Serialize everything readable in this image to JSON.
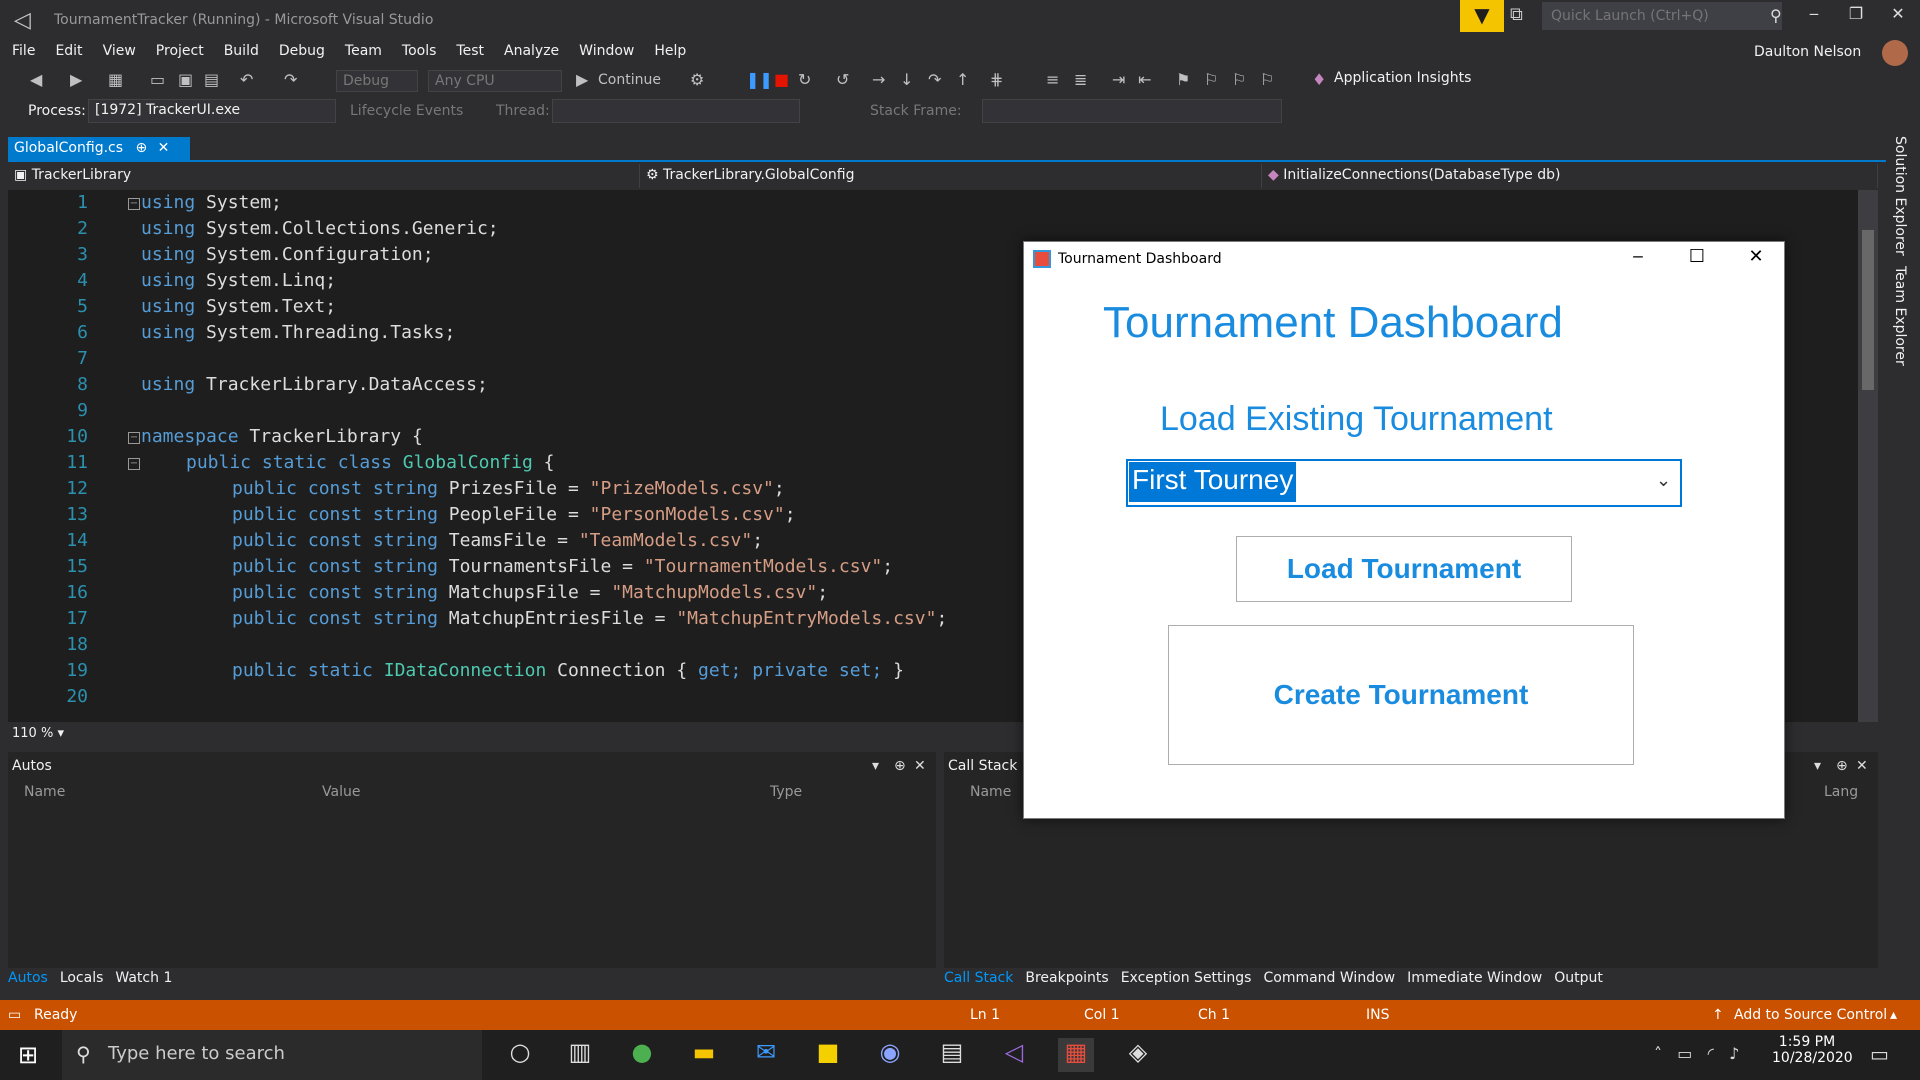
{
  "window": {
    "title": "TournamentTracker (Running) - Microsoft Visual Studio",
    "quick_launch_placeholder": "Quick Launch (Ctrl+Q)",
    "user": "Daulton Nelson"
  },
  "menu": [
    "File",
    "Edit",
    "View",
    "Project",
    "Build",
    "Debug",
    "Team",
    "Tools",
    "Test",
    "Analyze",
    "Window",
    "Help"
  ],
  "toolbar": {
    "config": "Debug",
    "platform": "Any CPU",
    "continue": "Continue",
    "app_insights": "Application Insights"
  },
  "debugbar": {
    "process_label": "Process:",
    "process_value": "[1972] TrackerUI.exe",
    "lifecycle": "Lifecycle Events",
    "thread_label": "Thread:",
    "stackframe_label": "Stack Frame:"
  },
  "editor": {
    "tab_name": "GlobalConfig.cs",
    "nav_project": "TrackerLibrary",
    "nav_class": "TrackerLibrary.GlobalConfig",
    "nav_member": "InitializeConnections(DatabaseType db)",
    "zoom": "110 %",
    "line_numbers": [
      "1",
      "2",
      "3",
      "4",
      "5",
      "6",
      "7",
      "8",
      "9",
      "10",
      "11",
      "12",
      "13",
      "14",
      "15",
      "16",
      "17",
      "18",
      "19",
      "20"
    ],
    "code": {
      "l1": "System;",
      "l2": "System.Collections.Generic;",
      "l3": "System.Configuration;",
      "l4": "System.Linq;",
      "l5": "System.Text;",
      "l6": "System.Threading.Tasks;",
      "l8": "TrackerLibrary.DataAccess;",
      "l10": "TrackerLibrary {",
      "l11_class": "GlobalConfig",
      "kw_using": "using",
      "kw_namespace": "namespace",
      "kw_public_static_class": "public static class",
      "kw_public_const_string": "public const string",
      "kw_public_static": "public static",
      "kw_get": "get;",
      "kw_private_set": "private set;",
      "type_idc": "IDataConnection",
      "prizes_name": "PrizesFile",
      "prizes_val": "\"PrizeModels.csv\"",
      "people_name": "PeopleFile",
      "people_val": "\"PersonModels.csv\"",
      "teams_name": "TeamsFile",
      "teams_val": "\"TeamModels.csv\"",
      "tourn_name": "TournamentsFile",
      "tourn_val": "\"TournamentModels.csv\"",
      "matchups_name": "MatchupsFile",
      "matchups_val": "\"MatchupModels.csv\"",
      "entries_name": "MatchupEntriesFile",
      "entries_val": "\"MatchupEntryModels.csv\"",
      "conn_name": "Connection {",
      "brace_open": "{",
      "brace_close": "}"
    }
  },
  "autos": {
    "title": "Autos",
    "columns": [
      "Name",
      "Value",
      "Type"
    ],
    "tabs": [
      "Autos",
      "Locals",
      "Watch 1"
    ]
  },
  "callstack": {
    "title": "Call Stack",
    "columns": [
      "Name",
      "Lang"
    ],
    "tabs": [
      "Call Stack",
      "Breakpoints",
      "Exception Settings",
      "Command Window",
      "Immediate Window",
      "Output"
    ]
  },
  "status": {
    "ready": "Ready",
    "ln": "Ln 1",
    "col": "Col 1",
    "ch": "Ch 1",
    "ins": "INS",
    "source_control": "Add to Source Control"
  },
  "side_tabs": [
    "Solution Explorer",
    "Team Explorer"
  ],
  "taskbar": {
    "search_placeholder": "Type here to search",
    "time": "1:59 PM",
    "date": "10/28/2020"
  },
  "dialog": {
    "title": "Tournament Dashboard",
    "heading": "Tournament Dashboard",
    "load_label": "Load Existing Tournament",
    "selected_tournament": "First Tourney",
    "load_button": "Load Tournament",
    "create_button": "Create Tournament"
  },
  "colors": {
    "accent": "#007acc",
    "status_bar": "#ca5100",
    "dialog_text": "#1a8ce0"
  }
}
